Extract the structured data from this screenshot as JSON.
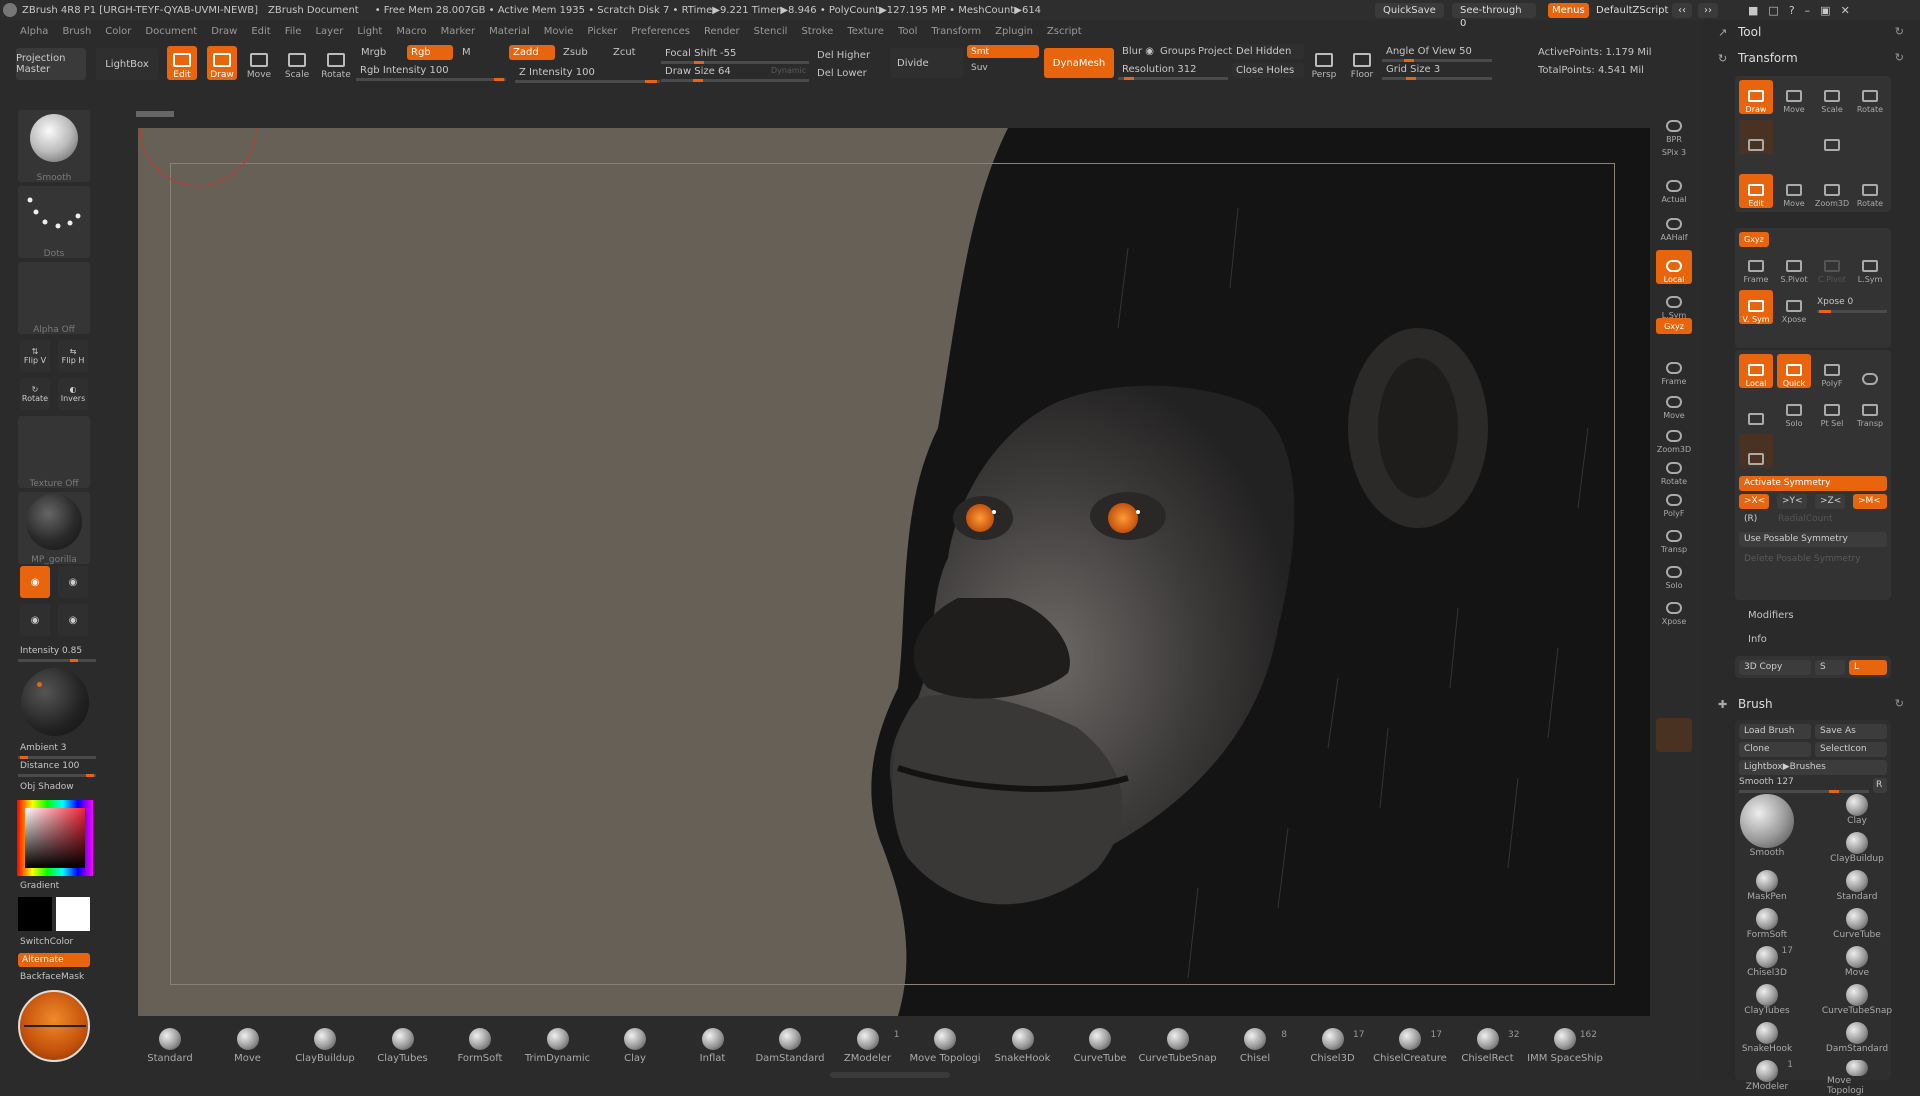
{
  "title": {
    "app": "ZBrush 4R8 P1 [URGH-TEYF-QYAB-UVMI-NEWB]",
    "doc": "ZBrush Document",
    "stats": "• Free Mem 28.007GB • Active Mem 1935 • Scratch Disk 7 • RTime▶9.221 Timer▶8.946 • PolyCount▶127.195 MP • MeshCount▶614",
    "quicksave": "QuickSave",
    "seethrough": "See-through  0",
    "menus": "Menus",
    "defaultzscript": "DefaultZScript"
  },
  "menu": [
    "Alpha",
    "Brush",
    "Color",
    "Document",
    "Draw",
    "Edit",
    "File",
    "Layer",
    "Light",
    "Macro",
    "Marker",
    "Material",
    "Movie",
    "Picker",
    "Preferences",
    "Render",
    "Stencil",
    "Stroke",
    "Texture",
    "Tool",
    "Transform",
    "Zplugin",
    "Zscript"
  ],
  "toolbar": {
    "projection_master": "Projection Master",
    "lightbox": "LightBox",
    "edit": "Edit",
    "draw": "Draw",
    "move": "Move",
    "scale": "Scale",
    "rotate": "Rotate",
    "mrgb": "Mrgb",
    "rgb": "Rgb",
    "m": "M",
    "zadd": "Zadd",
    "zsub": "Zsub",
    "zcut": "Zcut",
    "rgb_intensity": "Rgb Intensity 100",
    "rgb_intensity_value": 100,
    "z_intensity": "Z Intensity 100",
    "z_intensity_value": 100,
    "focal_shift": "Focal Shift -55",
    "focal_shift_value": -55,
    "draw_size": "Draw Size 64",
    "draw_size_value": 64,
    "dynamic": "Dynamic",
    "del_higher": "Del Higher",
    "del_lower": "Del Lower",
    "divide": "Divide",
    "smt": "Smt",
    "suv": "Suv",
    "dynamesh": "DynaMesh",
    "blur": "Blur",
    "groups": "Groups",
    "project": "Project",
    "resolution": "Resolution 312",
    "resolution_value": 312,
    "del_hidden": "Del Hidden",
    "close_holes": "Close Holes",
    "persp": "Persp",
    "floor": "Floor",
    "dynamic2": "Dynamic",
    "angle_of_view": "Angle Of View 50",
    "grid_size": "Grid Size 3",
    "active_points": "ActivePoints: 1.179 Mil",
    "total_points": "TotalPoints: 4.541 Mil"
  },
  "left": {
    "smooth": "Smooth",
    "dots": "Dots",
    "alpha_off": "Alpha Off",
    "flip_v": "Flip V",
    "flip_h": "Flip H",
    "rotate": "Rotate",
    "invers": "Invers",
    "texture_off": "Texture Off",
    "material": "MP_gorilla",
    "intensity": "Intensity 0.85",
    "intensity_value": 0.85,
    "ambient": "Ambient 3",
    "distance": "Distance 100",
    "shadow": "Obj Shadow",
    "gradient": "Gradient",
    "switchcolor": "SwitchColor",
    "alternate": "Alternate",
    "backfacemask": "BackfaceMask"
  },
  "right_shelf": [
    "BPR",
    "SPix 3",
    "Actual",
    "AAHalf",
    "Local",
    "L.Sym",
    "Gxyz",
    "Frame",
    "Move",
    "Zoom3D",
    "Rotate",
    "PolyF",
    "Transp",
    "Solo",
    "Xpose"
  ],
  "panel": {
    "tool": "Tool",
    "transform": "Transform",
    "draw": "Draw",
    "move": "Move",
    "scale": "Scale",
    "rotate": "Rotate",
    "edit": "Edit",
    "zoom3d": "Zoom3D",
    "xyz": "Gxyz",
    "frame": "Frame",
    "spivot": "S.Pivot",
    "cpivot": "C.Pivot",
    "lsym": "L.Sym",
    "vsym": "V. Sym",
    "xpose_btn": "Xpose",
    "xpose": "Xpose 0",
    "local": "Local",
    "quick": "Quick",
    "polyf": "PolyF",
    "solo": "Solo",
    "ptsel": "Pt Sel",
    "transp": "Transp",
    "activate_symmetry": "Activate Symmetry",
    "sym_x": ">X<",
    "sym_y": ">Y<",
    "sym_z": ">Z<",
    "sym_m": ">M<",
    "r": "(R)",
    "radialcount": "RadialCount",
    "use_posable": "Use Posable Symmetry",
    "delete_posable": "Delete Posable Symmetry",
    "modifiers": "Modifiers",
    "info": "Info",
    "copy3d": "3D Copy",
    "copy3d_s": "S",
    "copy3d_l": "L",
    "brush": "Brush",
    "load_brush": "Load Brush",
    "save_as": "Save As",
    "clone": "Clone",
    "selecticon": "SelectIcon",
    "lightbox_brushes": "Lightbox▶Brushes",
    "smooth": "Smooth  127",
    "r_label": "R",
    "brushes": [
      {
        "name": "Smooth",
        "count": ""
      },
      {
        "name": "Clay",
        "count": ""
      },
      {
        "name": "",
        "count": ""
      },
      {
        "name": "ClayBuildup",
        "count": ""
      },
      {
        "name": "MaskPen",
        "count": ""
      },
      {
        "name": "Standard",
        "count": ""
      },
      {
        "name": "FormSoft",
        "count": ""
      },
      {
        "name": "CurveTube",
        "count": ""
      },
      {
        "name": "Chisel3D",
        "count": "17"
      },
      {
        "name": "Move",
        "count": ""
      },
      {
        "name": "ClayTubes",
        "count": ""
      },
      {
        "name": "CurveTubeSnap",
        "count": ""
      },
      {
        "name": "SnakeHook",
        "count": ""
      },
      {
        "name": "DamStandard",
        "count": ""
      },
      {
        "name": "ZModeler",
        "count": "1"
      },
      {
        "name": "Move Topologi",
        "count": ""
      }
    ]
  },
  "bottom_brushes": [
    {
      "name": "Standard",
      "count": ""
    },
    {
      "name": "Move",
      "count": ""
    },
    {
      "name": "ClayBuildup",
      "count": ""
    },
    {
      "name": "ClayTubes",
      "count": ""
    },
    {
      "name": "FormSoft",
      "count": ""
    },
    {
      "name": "TrimDynamic",
      "count": ""
    },
    {
      "name": "Clay",
      "count": ""
    },
    {
      "name": "Inflat",
      "count": ""
    },
    {
      "name": "DamStandard",
      "count": ""
    },
    {
      "name": "ZModeler",
      "count": "1"
    },
    {
      "name": "Move Topologi",
      "count": ""
    },
    {
      "name": "SnakeHook",
      "count": ""
    },
    {
      "name": "CurveTube",
      "count": ""
    },
    {
      "name": "CurveTubeSnap",
      "count": ""
    },
    {
      "name": "Chisel",
      "count": "8"
    },
    {
      "name": "Chisel3D",
      "count": "17"
    },
    {
      "name": "ChiselCreature",
      "count": "17"
    },
    {
      "name": "ChiselRect",
      "count": "32"
    },
    {
      "name": "IMM SpaceShip",
      "count": "162"
    }
  ],
  "colors": {
    "accent": "#e8650e",
    "bg": "#2b2b2b",
    "canvas": "#676057"
  }
}
